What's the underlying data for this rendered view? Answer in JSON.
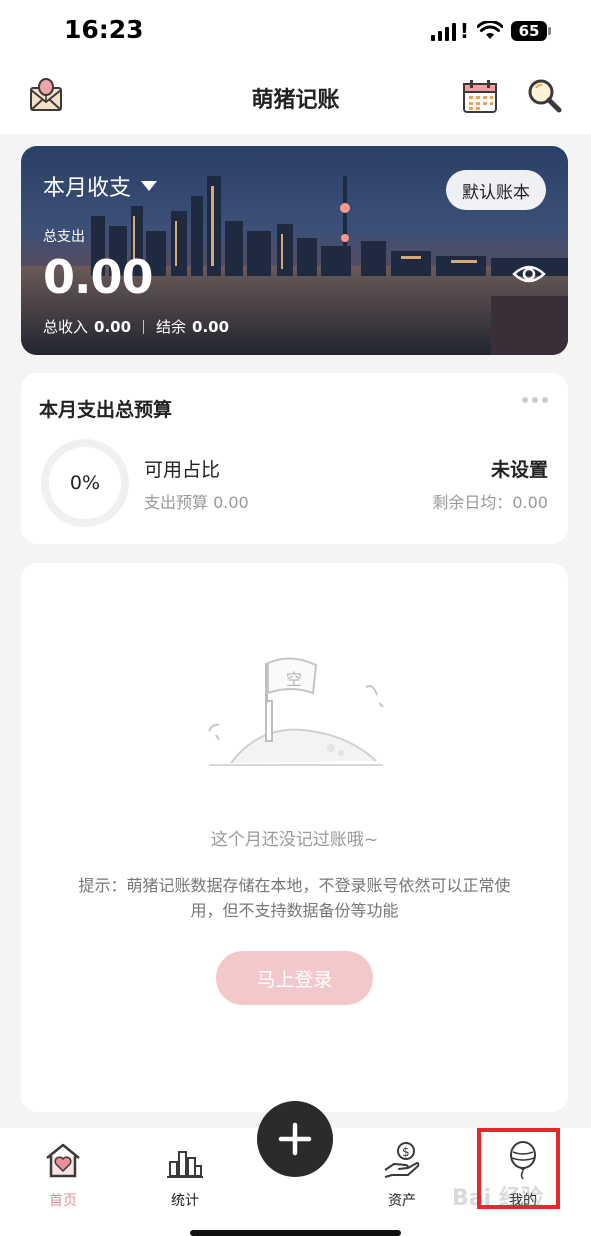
{
  "status_bar": {
    "time": "16:23",
    "battery": "65"
  },
  "header": {
    "title": "萌猪记账"
  },
  "summary": {
    "period_label": "本月收支",
    "book_button": "默认账本",
    "total_expense_label": "总支出",
    "total_expense_value": "0.00",
    "income_label": "总收入",
    "income_value": "0.00",
    "balance_label": "结余",
    "balance_value": "0.00"
  },
  "budget": {
    "title": "本月支出总预算",
    "ring_percent": "0%",
    "available_label": "可用占比",
    "budget_line": "支出预算 0.00",
    "status": "未设置",
    "daily_remaining": "剩余日均：0.00"
  },
  "empty_state": {
    "flag_char": "空",
    "message": "这个月还没记过账哦~",
    "tip": "提示：萌猪记账数据存储在本地，不登录账号依然可以正常使用，但不支持数据备份等功能",
    "login_button": "马上登录"
  },
  "tab_bar": {
    "items": [
      {
        "label": "首页",
        "icon": "house-heart-icon"
      },
      {
        "label": "统计",
        "icon": "bar-chart-icon"
      },
      {
        "label": "资产",
        "icon": "hand-coin-icon"
      },
      {
        "label": "我的",
        "icon": "balloon-icon"
      }
    ],
    "add_icon": "plus-icon"
  },
  "colors": {
    "accent_pink": "#e88f97",
    "login_button": "#f3c8cb",
    "highlight_box": "#e8262c"
  },
  "watermark": "Bai 经验"
}
